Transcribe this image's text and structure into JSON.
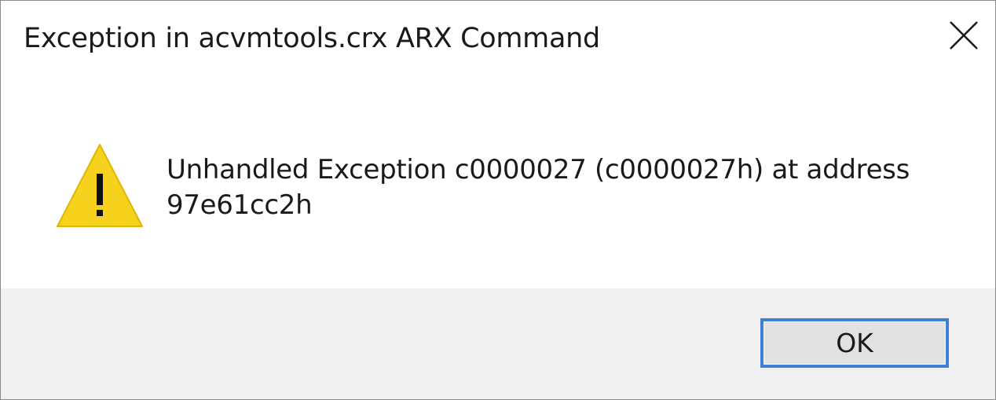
{
  "window": {
    "title": "Exception in acvmtools.crx ARX Command",
    "close_icon": "close-icon"
  },
  "message": {
    "icon": "warning-icon",
    "icon_color": "#f6d21c",
    "text": "Unhandled Exception c0000027 (c0000027h) at address 97e61cc2h"
  },
  "buttons": {
    "ok_label": "OK",
    "ok_focus_color": "#3c7fd9"
  },
  "colors": {
    "footer_bg": "#f0f0f0",
    "button_bg": "#e1e1e1"
  }
}
